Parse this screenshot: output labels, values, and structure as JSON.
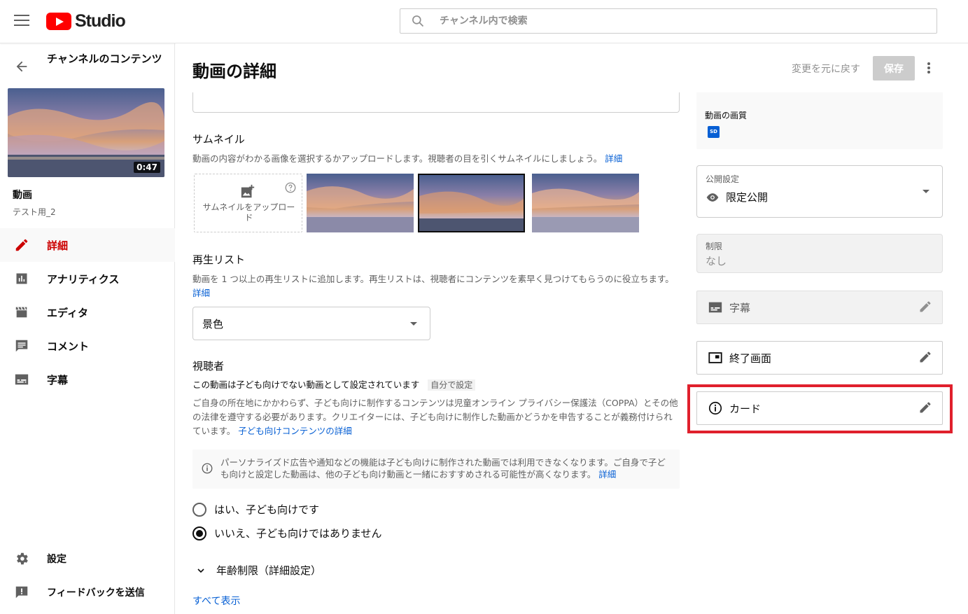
{
  "app": {
    "logo_text": "Studio"
  },
  "search": {
    "placeholder": "チャンネル内で検索"
  },
  "sidebar": {
    "title": "チャンネルのコンテンツ",
    "duration": "0:47",
    "video_label": "動画",
    "video_name": "テスト用_2",
    "items": [
      {
        "label": "詳細",
        "icon": "pencil-icon",
        "active": true
      },
      {
        "label": "アナリティクス",
        "icon": "analytics-icon"
      },
      {
        "label": "エディタ",
        "icon": "clapper-icon"
      },
      {
        "label": "コメント",
        "icon": "comment-icon"
      },
      {
        "label": "字幕",
        "icon": "subtitles-icon"
      }
    ],
    "bottom_items": [
      {
        "label": "設定",
        "icon": "gear-icon"
      },
      {
        "label": "フィードバックを送信",
        "icon": "feedback-icon"
      }
    ]
  },
  "header": {
    "title": "動画の詳細",
    "undo_label": "変更を元に戻す",
    "save_label": "保存"
  },
  "thumbnail": {
    "title": "サムネイル",
    "desc": "動画の内容がわかる画像を選択するかアップロードします。視聴者の目を引くサムネイルにしましょう。",
    "link": "詳細",
    "upload_label": "サムネイルをアップロード"
  },
  "playlist": {
    "title": "再生リスト",
    "desc": "動画を 1 つ以上の再生リストに追加します。再生リストは、視聴者にコンテンツを素早く見つけてもらうのに役立ちます。",
    "link": "詳細",
    "selected": "景色"
  },
  "audience": {
    "title": "視聴者",
    "status": "この動画は子ども向けでない動画として設定されています",
    "tag": "自分で設定",
    "desc": "ご自身の所在地にかかわらず、子ども向けに制作するコンテンツは児童オンライン プライバシー保護法（COPPA）とその他の法律を遵守する必要があります。クリエイターには、子ども向けに制作した動画かどうかを申告することが義務付けられています。",
    "desc_link": "子ども向けコンテンツの詳細",
    "notice": "パーソナライズド広告や通知などの機能は子ども向けに制作された動画では利用できなくなります。ご自身で子ども向けと設定した動画は、他の子ども向け動画と一緒におすすめされる可能性が高くなります。",
    "notice_link": "詳細",
    "option_yes": "はい、子ども向けです",
    "option_no": "いいえ、子ども向けではありません",
    "selected": "no",
    "age_restriction": "年齢制限（詳細設定）",
    "show_all": "すべて表示"
  },
  "right": {
    "quality_label": "動画の画質",
    "quality_badge": "SD",
    "visibility_label": "公開設定",
    "visibility_value": "限定公開",
    "restriction_label": "制限",
    "restriction_value": "なし",
    "subtitles_label": "字幕",
    "end_screen_label": "終了画面",
    "cards_label": "カード"
  },
  "colors": {
    "accent": "#cc0000",
    "link": "#065fd4",
    "highlight": "#e0202c"
  }
}
